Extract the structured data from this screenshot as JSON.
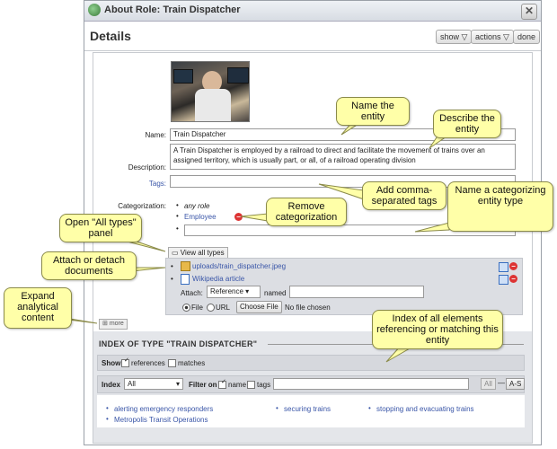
{
  "window": {
    "title": "About Role: Train Dispatcher",
    "close_glyph": "✕"
  },
  "header": {
    "title": "Details",
    "show_label": "show ▽",
    "actions_label": "actions ▽",
    "done_label": "done"
  },
  "form": {
    "name_label": "Name:",
    "name_value": "Train Dispatcher",
    "description_label": "Description:",
    "description_value": "A Train Dispatcher is employed by a railroad to direct and facilitate the movement of trains over an assigned territory, which is usually part, or all, of a railroad operating division",
    "tags_label": "Tags:",
    "categorization_label": "Categorization:",
    "categories": [
      "any role",
      "Employee"
    ],
    "view_all_types": "View all types"
  },
  "attachments": {
    "files": [
      "uploads/train_dispatcher.jpeg",
      "Wikipedia article"
    ],
    "attach_label": "Attach:",
    "attach_type": "Reference ▾",
    "named_label": "named",
    "file_radio": "File",
    "url_radio": "URL",
    "choose_file": "Choose File",
    "no_file": "No file chosen",
    "more_label": "more"
  },
  "index": {
    "title": "INDEX OF TYPE \"TRAIN DISPATCHER\"",
    "show_label": "Show",
    "references_label": "references",
    "matches_label": "matches",
    "index_label": "Index",
    "index_select": "All",
    "filter_label": "Filter on",
    "name_label": "name",
    "tags_label": "tags",
    "all_btn": "All",
    "dash": "—",
    "as_btn": "A-S",
    "items": [
      "alerting emergency responders",
      "Metropolis Transit Operations",
      "securing trains",
      "stopping and evacuating trains"
    ]
  },
  "callouts": {
    "name_entity": "Name the entity",
    "describe_entity": "Describe the entity",
    "add_tags": "Add comma-separated tags",
    "remove_cat": "Remove categorization",
    "name_cat": "Name a categorizing entity type",
    "open_all": "Open \"All types\" panel",
    "attach_docs": "Attach or detach documents",
    "expand": "Expand analytical content",
    "index_all": "Index of all elements referencing or matching this entity"
  },
  "colors": {
    "callout_bg": "#ffffa8",
    "link": "#3a56a8",
    "remove": "#dd3333",
    "panel_bg": "#e4e6ea"
  }
}
